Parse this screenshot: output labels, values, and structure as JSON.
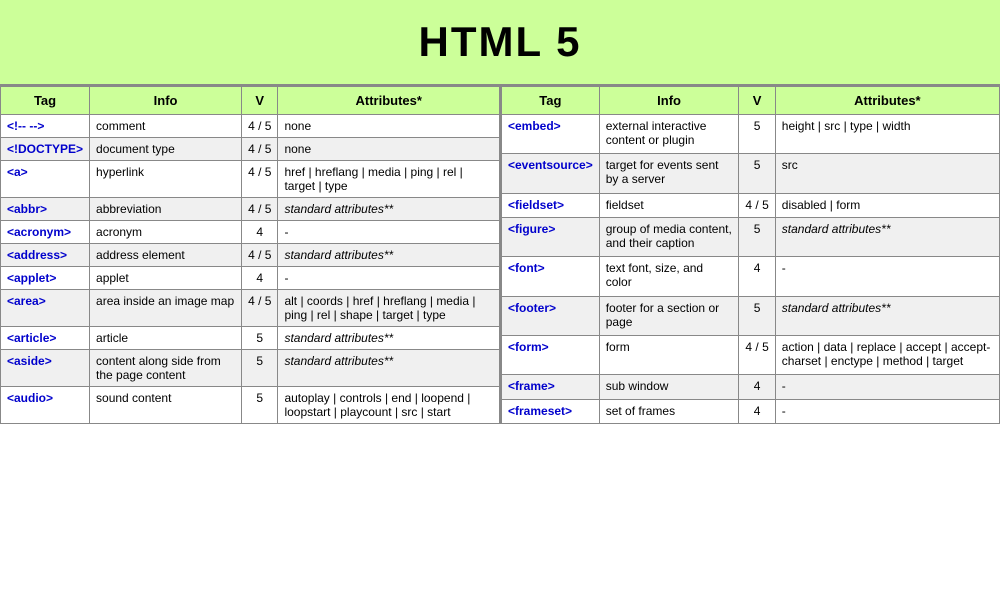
{
  "header": {
    "title": "HTML 5"
  },
  "left_table": {
    "columns": [
      "Tag",
      "Info",
      "V",
      "Attributes*"
    ],
    "rows": [
      {
        "tag": "<!-- -->",
        "info": "comment",
        "v": "4 / 5",
        "attrs": "none",
        "attr_italic": false
      },
      {
        "tag": "<!DOCTYPE>",
        "info": "document type",
        "v": "4 / 5",
        "attrs": "none",
        "attr_italic": false
      },
      {
        "tag": "<a>",
        "info": "hyperlink",
        "v": "4 / 5",
        "attrs": "href | hreflang | media | ping | rel | target | type",
        "attr_italic": false
      },
      {
        "tag": "<abbr>",
        "info": "abbreviation",
        "v": "4 / 5",
        "attrs": "standard attributes**",
        "attr_italic": true
      },
      {
        "tag": "<acronym>",
        "info": "acronym",
        "v": "4",
        "attrs": "-",
        "attr_italic": false
      },
      {
        "tag": "<address>",
        "info": "address element",
        "v": "4 / 5",
        "attrs": "standard attributes**",
        "attr_italic": true
      },
      {
        "tag": "<applet>",
        "info": "applet",
        "v": "4",
        "attrs": "-",
        "attr_italic": false
      },
      {
        "tag": "<area>",
        "info": "area inside an image map",
        "v": "4 / 5",
        "attrs": "alt | coords | href | hreflang | media | ping | rel | shape | target | type",
        "attr_italic": false
      },
      {
        "tag": "<article>",
        "info": "article",
        "v": "5",
        "attrs": "standard attributes**",
        "attr_italic": true
      },
      {
        "tag": "<aside>",
        "info": "content along side from the page content",
        "v": "5",
        "attrs": "standard attributes**",
        "attr_italic": true
      },
      {
        "tag": "<audio>",
        "info": "sound content",
        "v": "5",
        "attrs": "autoplay | controls | end | loopend | loopstart | playcount | src | start",
        "attr_italic": false
      }
    ]
  },
  "right_table": {
    "columns": [
      "Tag",
      "Info",
      "V",
      "Attributes*"
    ],
    "rows": [
      {
        "tag": "<embed>",
        "info": "external interactive content or plugin",
        "v": "5",
        "attrs": "height | src | type | width",
        "attr_italic": false
      },
      {
        "tag": "<eventsource>",
        "info": "target for events sent by a server",
        "v": "5",
        "attrs": "src",
        "attr_italic": false
      },
      {
        "tag": "<fieldset>",
        "info": "fieldset",
        "v": "4 / 5",
        "attrs": "disabled | form",
        "attr_italic": false
      },
      {
        "tag": "<figure>",
        "info": "group of media content, and their caption",
        "v": "5",
        "attrs": "standard attributes**",
        "attr_italic": true
      },
      {
        "tag": "<font>",
        "info": "text font, size, and color",
        "v": "4",
        "attrs": "-",
        "attr_italic": false
      },
      {
        "tag": "<footer>",
        "info": "footer for a section or page",
        "v": "5",
        "attrs": "standard attributes**",
        "attr_italic": true
      },
      {
        "tag": "<form>",
        "info": "form",
        "v": "4 / 5",
        "attrs": "action | data | replace | accept | accept-charset | enctype | method | target",
        "attr_italic": false
      },
      {
        "tag": "<frame>",
        "info": "sub window",
        "v": "4",
        "attrs": "-",
        "attr_italic": false
      },
      {
        "tag": "<frameset>",
        "info": "set of frames",
        "v": "4",
        "attrs": "-",
        "attr_italic": false
      }
    ]
  }
}
